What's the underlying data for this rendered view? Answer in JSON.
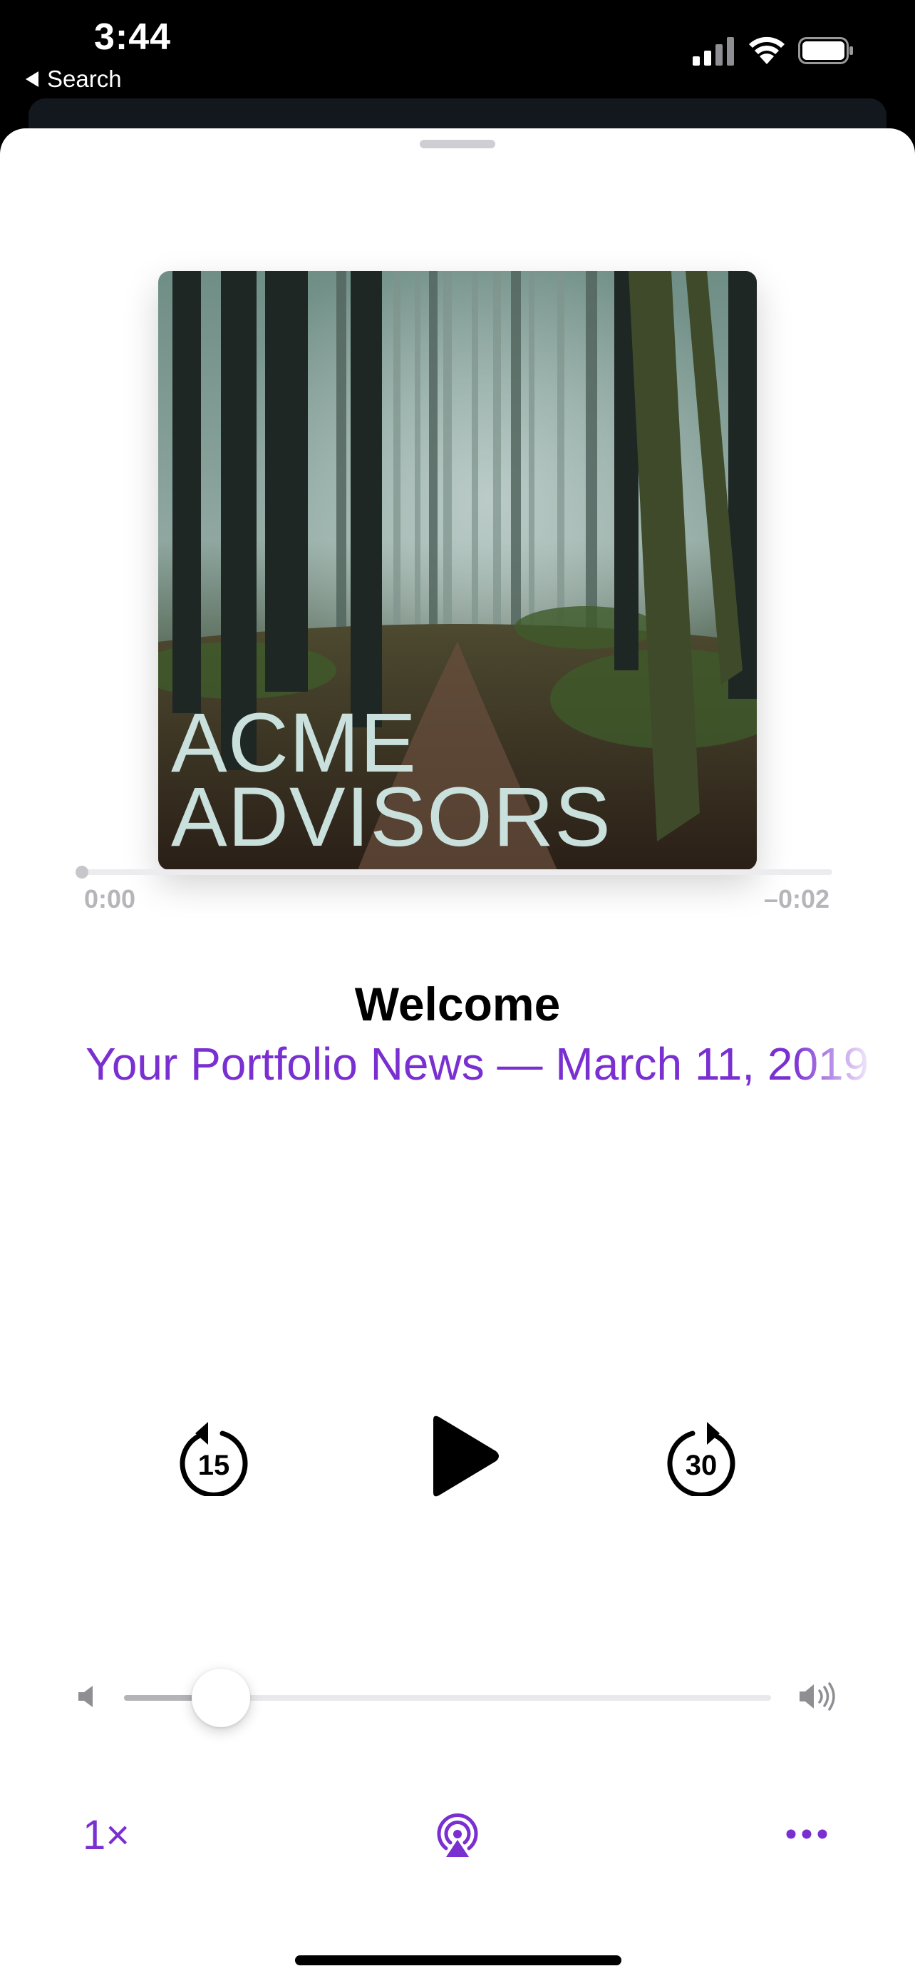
{
  "status_bar": {
    "time": "3:44",
    "back_label": "Search"
  },
  "artwork": {
    "line1": "ACME",
    "line2": "ADVISORS"
  },
  "progress": {
    "elapsed": "0:00",
    "remaining": "–0:02",
    "fraction": 0
  },
  "episode": {
    "title": "Welcome",
    "show": "Your Portfolio News — March 11, 2019"
  },
  "controls": {
    "skip_back_seconds": "15",
    "skip_forward_seconds": "30"
  },
  "volume": {
    "level": 0.15
  },
  "bottom_bar": {
    "speed": "1×"
  },
  "colors": {
    "accent": "#7a2fd1"
  }
}
